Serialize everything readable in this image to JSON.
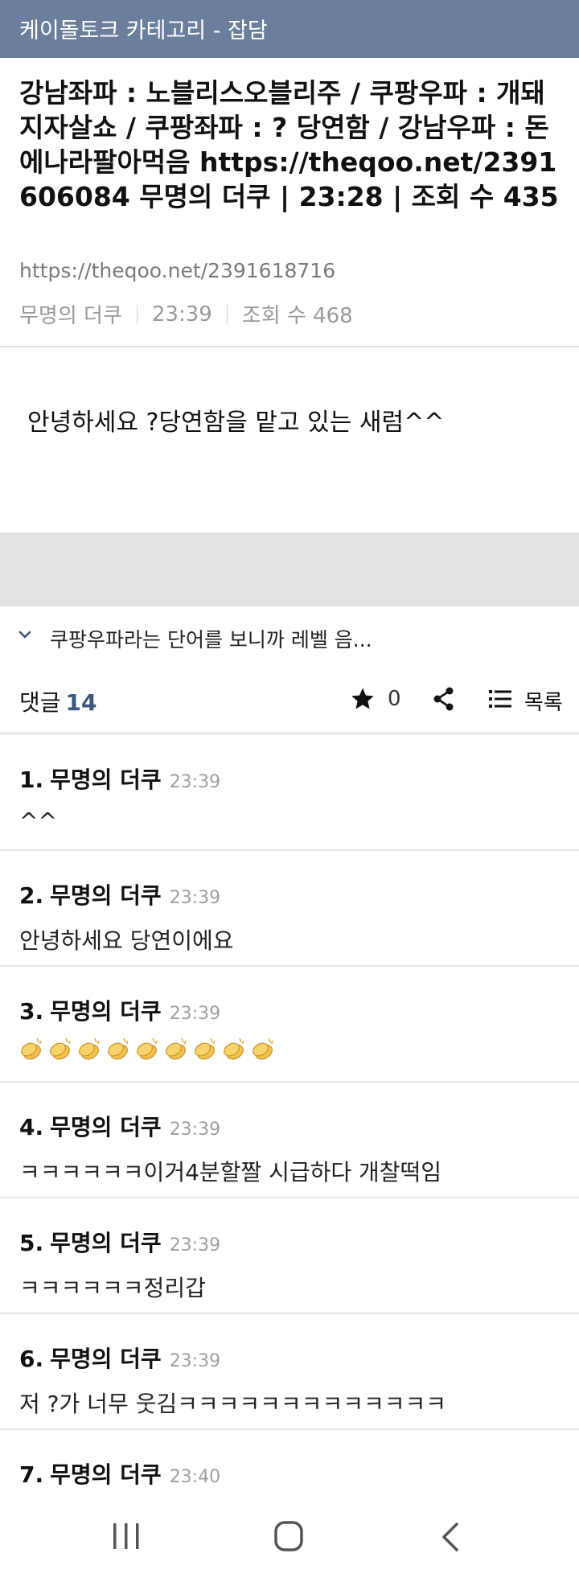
{
  "topbar": {
    "title": "케이돌토크 카테고리 - 잡담"
  },
  "post": {
    "title": "강남좌파 : 노블리스오블리주 / 쿠팡우파 : 개돼지자살쇼 / 쿠팡좌파 : ? 당연함 / 강남우파 : 돈에나라팔아먹음 https://theqoo.net/2391606084 무명의 더쿠 | 23:28 | 조회 수 435",
    "url": "https://theqoo.net/2391618716",
    "author": "무명의 더쿠",
    "time": "23:39",
    "views": "조회 수 468",
    "body": "안녕하세요 ?당연함을 맡고 있는 새럼^^"
  },
  "next_post": {
    "title": "쿠팡우파라는 단어를 보니까 레벨 음..."
  },
  "comment_bar": {
    "label": "댓글",
    "count": "14",
    "star_count": "0",
    "list_label": "목록"
  },
  "comments": [
    {
      "num": "1.",
      "author": "무명의 더쿠",
      "time": "23:39",
      "text": "^^"
    },
    {
      "num": "2.",
      "author": "무명의 더쿠",
      "time": "23:39",
      "text": "안녕하세요 당연이에요"
    },
    {
      "num": "3.",
      "author": "무명의 더쿠",
      "time": "23:39",
      "text": "",
      "icons": "clapping-hands-icon x9"
    },
    {
      "num": "4.",
      "author": "무명의 더쿠",
      "time": "23:39",
      "text": "ㅋㅋㅋㅋㅋㅋ이거4분할짤 시급하다 개찰떡임"
    },
    {
      "num": "5.",
      "author": "무명의 더쿠",
      "time": "23:39",
      "text": "ㅋㅋㅋㅋㅋㅋ정리갑"
    },
    {
      "num": "6.",
      "author": "무명의 더쿠",
      "time": "23:39",
      "text": "저 ?가 너무 웃김ㅋㅋㅋㅋㅋㅋㅋㅋㅋㅋㅋㅋㅋ"
    },
    {
      "num": "7.",
      "author": "무명의 더쿠",
      "time": "23:40",
      "text": ""
    }
  ],
  "colors": {
    "topbar": "#6b7f9c",
    "comment_count": "#3b5780",
    "band": "#e3e3e3"
  }
}
